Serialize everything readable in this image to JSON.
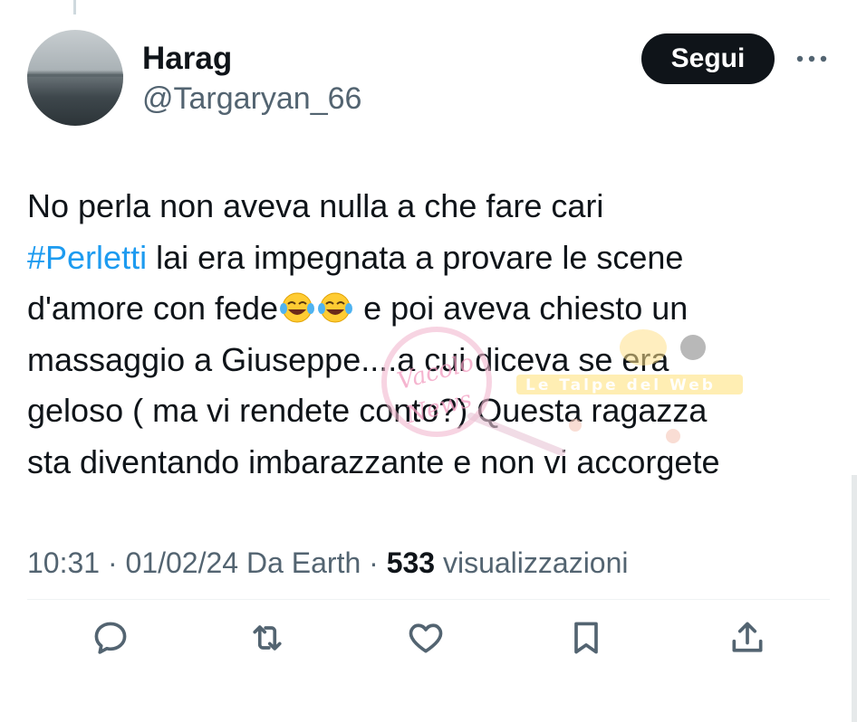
{
  "author": {
    "name": "Harag",
    "handle": "@Targaryan_66",
    "avatar_icon": "avatar-seascape"
  },
  "follow_label": "Segui",
  "more_icon": "more-horizontal-icon",
  "tweet": {
    "line1": "No perla non aveva nulla a che fare cari",
    "hashtag": "#Perletti",
    "line2_rest": " lai era impegnata a provare le scene",
    "line3_before_emoji": "d'amore con fede",
    "line3_after_emoji": " e poi aveva chiesto un",
    "line4": "massaggio a Giuseppe....a cui diceva se era",
    "line5": "geloso ( ma vi rendete conto?) Questa ragazza",
    "line6": "sta diventando imbarazzante e non vi accorgete",
    "emoji_name": "face-with-tears-of-joy"
  },
  "meta": {
    "time": "10:31",
    "date": "01/02/24",
    "source": "Da Earth",
    "views_count": "533",
    "views_label": "visualizzazioni",
    "separator": "·"
  },
  "watermark": {
    "script_text": "Vacolo delle News",
    "banner_text": "Le Talpe del Web"
  },
  "actions": [
    {
      "name": "reply",
      "icon": "reply-icon"
    },
    {
      "name": "retweet",
      "icon": "retweet-icon"
    },
    {
      "name": "like",
      "icon": "heart-icon"
    },
    {
      "name": "bookmark",
      "icon": "bookmark-icon"
    },
    {
      "name": "share",
      "icon": "share-icon"
    }
  ],
  "colors": {
    "text": "#0f1419",
    "secondary": "#536471",
    "link": "#1d9bf0",
    "button_bg": "#0f1419",
    "button_text": "#ffffff"
  }
}
